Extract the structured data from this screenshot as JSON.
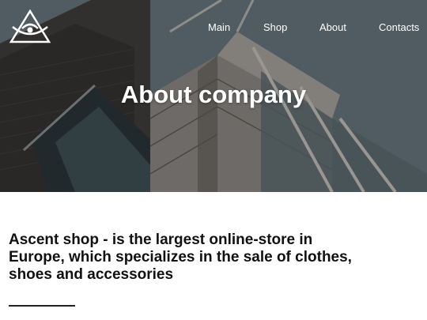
{
  "nav": {
    "items": [
      "Main",
      "Shop",
      "About",
      "Contacts"
    ]
  },
  "hero": {
    "title": "About company"
  },
  "intro": {
    "text": "Ascent shop - is the largest online-store in Europe, which specializes in the sale of clothes, shoes and accessories"
  },
  "icons": {
    "logo": "eye-in-triangle-logo-icon"
  },
  "colors": {
    "hero_overlay": "#5f6c70",
    "text_dark": "#111111",
    "nav_text": "#ffffff"
  }
}
